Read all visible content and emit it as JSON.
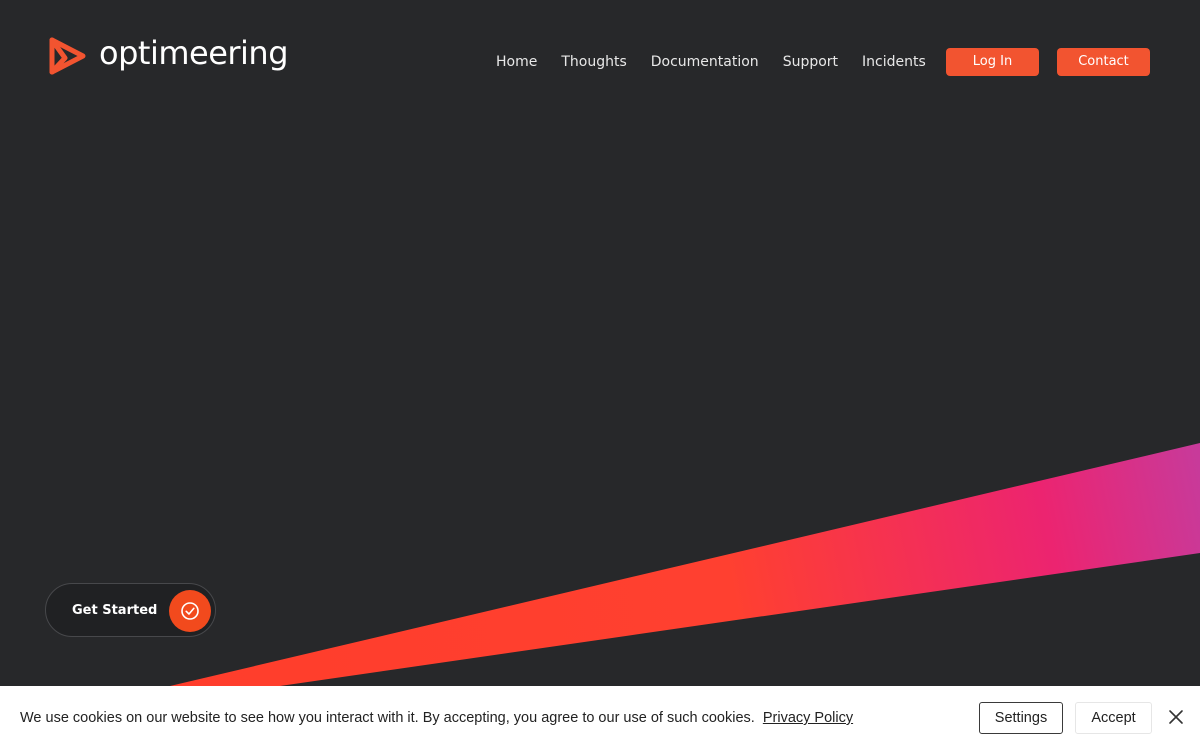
{
  "brand": {
    "name": "optimeering",
    "logo_icon": "play-triangle-logo-icon",
    "accent_color": "#f25430"
  },
  "nav": {
    "items": [
      "Home",
      "Thoughts",
      "Documentation",
      "Support",
      "Incidents"
    ]
  },
  "header_buttons": {
    "login_label": "Log In",
    "contact_label": "Contact"
  },
  "hero": {
    "cta_label": "Get Started",
    "cta_icon": "check-circle-icon",
    "background_color": "#27282a",
    "beam_colors": [
      "#ff3d2b",
      "#ec2470",
      "#c83a9a"
    ]
  },
  "cookie_banner": {
    "message": "We use cookies on our website to see how you interact with it. By accepting, you agree to our use of such cookies.",
    "privacy_link": "Privacy Policy",
    "settings_label": "Settings",
    "accept_label": "Accept",
    "close_icon": "close-icon"
  }
}
